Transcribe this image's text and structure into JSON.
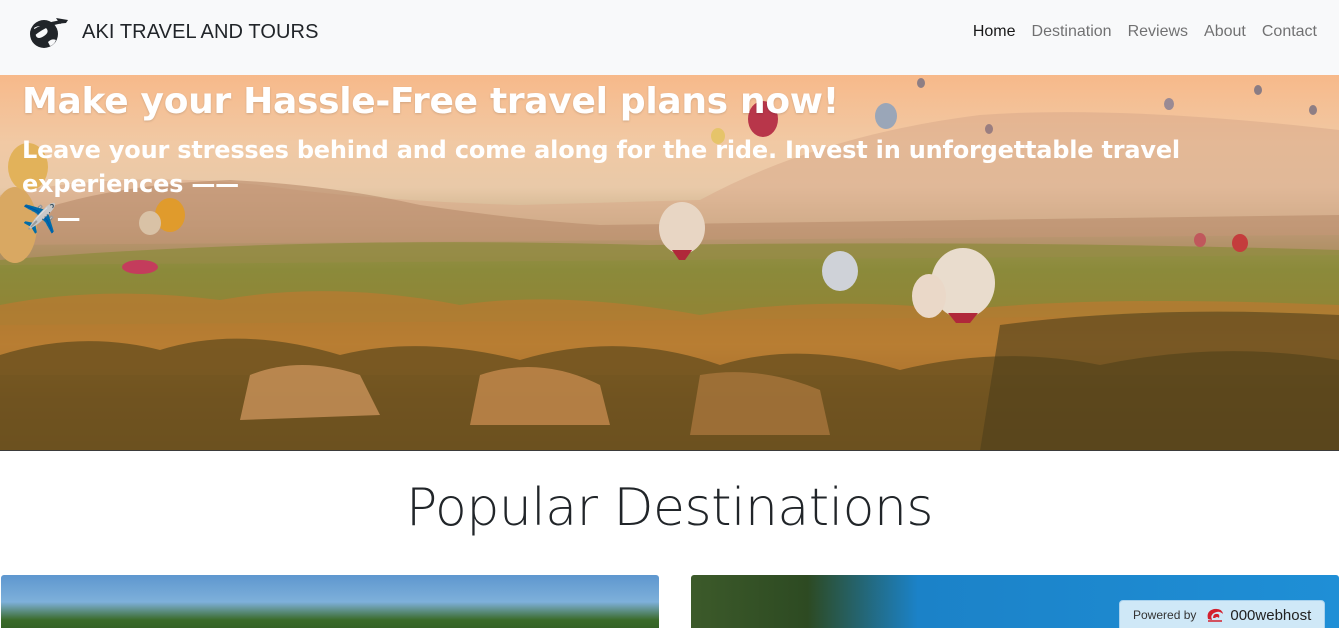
{
  "navbar": {
    "brand": "AKI TRAVEL AND TOURS",
    "logo_icon": "globe-plane-icon",
    "links": [
      {
        "label": "Home",
        "active": true
      },
      {
        "label": "Destination",
        "active": false
      },
      {
        "label": "Reviews",
        "active": false
      },
      {
        "label": "About",
        "active": false
      },
      {
        "label": "Contact",
        "active": false
      }
    ]
  },
  "hero": {
    "title": "Make your Hassle-Free travel plans now!",
    "subtitle": "Leave your stresses behind and come along for the ride. Invest in unforgettable travel experiences ——",
    "subtitle_emoji": "✈️",
    "subtitle_tail": "—"
  },
  "section": {
    "title": "Popular Destinations"
  },
  "badge": {
    "label": "Powered by",
    "brand": "000webhost"
  },
  "colors": {
    "navbar_bg": "#f8f9fa",
    "badge_bg": "#cfe8f7",
    "hero_text": "#ffffff"
  }
}
